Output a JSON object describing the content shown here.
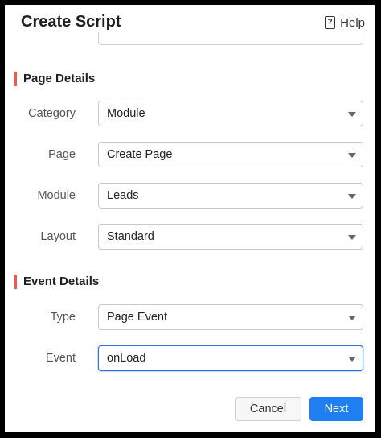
{
  "dialog": {
    "title": "Create Script",
    "help_label": "Help",
    "help_icon": "?"
  },
  "page_details": {
    "section_title": "Page Details",
    "fields": [
      {
        "label": "Category",
        "value": "Module"
      },
      {
        "label": "Page",
        "value": "Create Page"
      },
      {
        "label": "Module",
        "value": "Leads"
      },
      {
        "label": "Layout",
        "value": "Standard"
      }
    ]
  },
  "event_details": {
    "section_title": "Event Details",
    "fields": [
      {
        "label": "Type",
        "value": "Page Event"
      },
      {
        "label": "Event",
        "value": "onLoad"
      }
    ]
  },
  "footer": {
    "cancel_label": "Cancel",
    "next_label": "Next"
  },
  "colors": {
    "accent": "#1f7ef0",
    "section_marker": "#ee5a4a",
    "focus_border": "#2f6fea"
  }
}
